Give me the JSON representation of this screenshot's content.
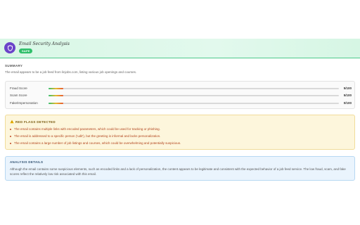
{
  "header": {
    "title": "Email Security Analysis",
    "badge": "SAFE",
    "icon": "shield-icon",
    "colors": {
      "header_bg": "#e0f8eb",
      "border": "#4cc98a",
      "badge": "#2fbf6a",
      "icon_bg": "#6b44c9"
    }
  },
  "summary": {
    "label": "SUMMARY",
    "text": "The email appears to be a job feed from linjobs.com, listing various job openings and courses."
  },
  "scores": [
    {
      "label": "Fraud Score",
      "value": "5/100",
      "fraction": 0.05
    },
    {
      "label": "Scam Score",
      "value": "5/100",
      "fraction": 0.05
    },
    {
      "label": "Fake/Impersonation",
      "value": "0/100",
      "fraction": 0.05
    }
  ],
  "red_flags": {
    "heading": "RED FLAGS DETECTED",
    "icon": "warning-icon",
    "items": [
      "The email contains multiple links with encoded parameters, which could be used for tracking or phishing.",
      "The email is addressed to a specific person ('udit'), but the greeting is informal and lacks personalization.",
      "The email contains a large number of job listings and courses, which could be overwhelming and potentially suspicious."
    ]
  },
  "details": {
    "heading": "ANALYSIS DETAILS",
    "text": "Although the email contains some suspicious elements, such as encoded links and a lack of personalization, the content appears to be legitimate and consistent with the expected behavior of a job feed service. The low fraud, scam, and fake scores reflect the relatively low risk associated with this email."
  }
}
